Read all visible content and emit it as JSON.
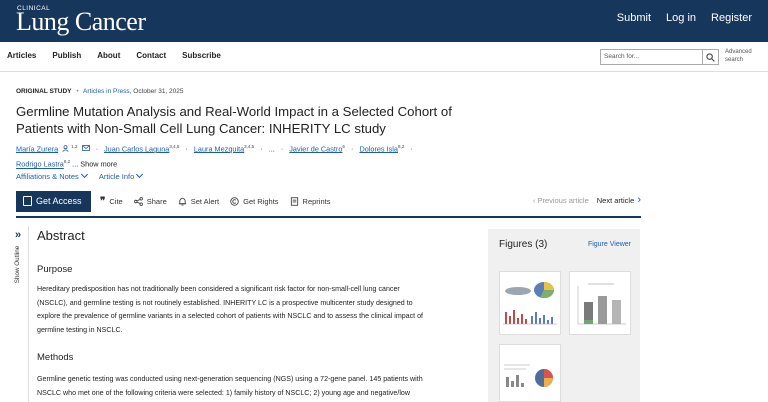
{
  "header": {
    "logo_small": "CLINICAL",
    "logo_main": "Lung Cancer",
    "links": [
      "Submit",
      "Log in",
      "Register"
    ]
  },
  "nav": {
    "items": [
      "Articles",
      "Publish",
      "About",
      "Contact",
      "Subscribe"
    ],
    "search_placeholder": "Search for...",
    "advanced_search": "Advanced search"
  },
  "article": {
    "study_type": "ORIGINAL STUDY",
    "separator": "•",
    "status": "Articles in Press",
    "date": "October 31, 2025",
    "title": "Germline Mutation Analysis and Real-World Impact in a Selected Cohort of Patients with Non-Small Cell Lung Cancer: INHERITY LC study",
    "authors": [
      {
        "name": "María Zurera",
        "sup": "1,2"
      },
      {
        "name": "Juan Carlos Laguna",
        "sup": "3,4,5"
      },
      {
        "name": "Laura Mezquita",
        "sup": "3,4,5"
      },
      {
        "name": "Javier de Castro",
        "sup": "6"
      },
      {
        "name": "Dolores Isla",
        "sup": "8,2"
      },
      {
        "name": "Rodrigo Lastra",
        "sup": "8,2"
      }
    ],
    "ellipsis": "...",
    "show_more": "Show more",
    "affiliations": "Affiliations & Notes",
    "article_info": "Article Info"
  },
  "toolbar": {
    "get_access": "Get Access",
    "cite": "Cite",
    "share": "Share",
    "set_alert": "Set Alert",
    "get_rights": "Get Rights",
    "reprints": "Reprints",
    "previous": "Previous article",
    "next": "Next article"
  },
  "outline": {
    "label": "Show Outline"
  },
  "abstract": {
    "heading": "Abstract",
    "purpose_heading": "Purpose",
    "purpose_lines": [
      "Hereditary predisposition has not traditionally been considered a significant risk factor for non-small-cell lung cancer",
      "(NSCLC), and germline testing is not routinely established. INHERITY LC is a prospective multicenter study designed to",
      "explore the prevalence of germline variants in a selected cohort of patients with NSCLC and to assess the clinical impact of",
      "germline testing in NSCLC."
    ],
    "methods_heading": "Methods",
    "methods_lines": [
      "Germline genetic testing was conducted using next-generation sequencing (NGS) using a 72-gene panel. 145 patients with",
      "NSCLC who met one of the following criteria were selected: 1) family history of NSCLC; 2) young age and negative/low"
    ]
  },
  "figures": {
    "title": "Figures (3)",
    "viewer": "Figure Viewer"
  },
  "colors": {
    "brand_navy": "#17365c",
    "link_blue": "#1e5ea8"
  }
}
